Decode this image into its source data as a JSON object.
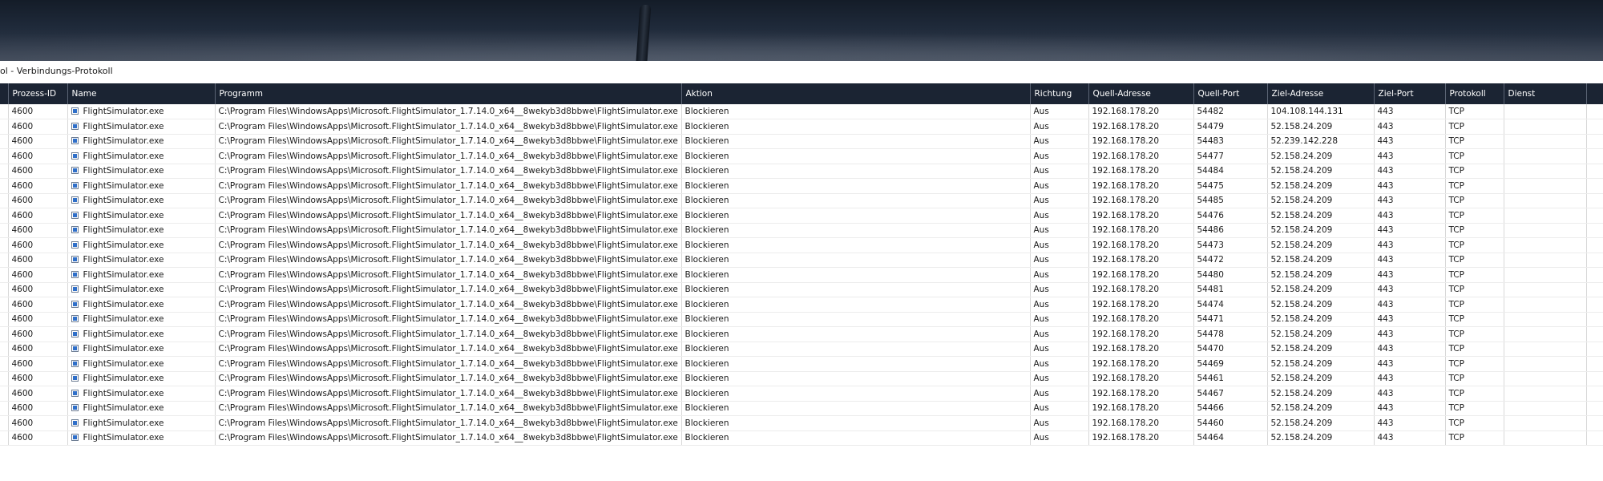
{
  "window": {
    "title": "ol - Verbindungs-Protokoll"
  },
  "icons": {
    "row_app_icon": "application-icon"
  },
  "colors": {
    "header_bg": "#1b2433",
    "header_text": "#ffffff",
    "row_border": "#ececec"
  },
  "table": {
    "columns": [
      "",
      "Prozess-ID",
      "Name",
      "Programm",
      "Aktion",
      "Richtung",
      "Quell-Adresse",
      "Quell-Port",
      "Ziel-Adresse",
      "Ziel-Port",
      "Protokoll",
      "Dienst",
      ""
    ],
    "rows": [
      {
        "pid": "4600",
        "name": "FlightSimulator.exe",
        "program": "C:\\Program Files\\WindowsApps\\Microsoft.FlightSimulator_1.7.14.0_x64__8wekyb3d8bbwe\\FlightSimulator.exe",
        "action": "Blockieren",
        "direction": "Aus",
        "src_addr": "192.168.178.20",
        "src_port": "54482",
        "dst_addr": "104.108.144.131",
        "dst_port": "443",
        "protocol": "TCP",
        "service": ""
      },
      {
        "pid": "4600",
        "name": "FlightSimulator.exe",
        "program": "C:\\Program Files\\WindowsApps\\Microsoft.FlightSimulator_1.7.14.0_x64__8wekyb3d8bbwe\\FlightSimulator.exe",
        "action": "Blockieren",
        "direction": "Aus",
        "src_addr": "192.168.178.20",
        "src_port": "54479",
        "dst_addr": "52.158.24.209",
        "dst_port": "443",
        "protocol": "TCP",
        "service": ""
      },
      {
        "pid": "4600",
        "name": "FlightSimulator.exe",
        "program": "C:\\Program Files\\WindowsApps\\Microsoft.FlightSimulator_1.7.14.0_x64__8wekyb3d8bbwe\\FlightSimulator.exe",
        "action": "Blockieren",
        "direction": "Aus",
        "src_addr": "192.168.178.20",
        "src_port": "54483",
        "dst_addr": "52.239.142.228",
        "dst_port": "443",
        "protocol": "TCP",
        "service": ""
      },
      {
        "pid": "4600",
        "name": "FlightSimulator.exe",
        "program": "C:\\Program Files\\WindowsApps\\Microsoft.FlightSimulator_1.7.14.0_x64__8wekyb3d8bbwe\\FlightSimulator.exe",
        "action": "Blockieren",
        "direction": "Aus",
        "src_addr": "192.168.178.20",
        "src_port": "54477",
        "dst_addr": "52.158.24.209",
        "dst_port": "443",
        "protocol": "TCP",
        "service": ""
      },
      {
        "pid": "4600",
        "name": "FlightSimulator.exe",
        "program": "C:\\Program Files\\WindowsApps\\Microsoft.FlightSimulator_1.7.14.0_x64__8wekyb3d8bbwe\\FlightSimulator.exe",
        "action": "Blockieren",
        "direction": "Aus",
        "src_addr": "192.168.178.20",
        "src_port": "54484",
        "dst_addr": "52.158.24.209",
        "dst_port": "443",
        "protocol": "TCP",
        "service": ""
      },
      {
        "pid": "4600",
        "name": "FlightSimulator.exe",
        "program": "C:\\Program Files\\WindowsApps\\Microsoft.FlightSimulator_1.7.14.0_x64__8wekyb3d8bbwe\\FlightSimulator.exe",
        "action": "Blockieren",
        "direction": "Aus",
        "src_addr": "192.168.178.20",
        "src_port": "54475",
        "dst_addr": "52.158.24.209",
        "dst_port": "443",
        "protocol": "TCP",
        "service": ""
      },
      {
        "pid": "4600",
        "name": "FlightSimulator.exe",
        "program": "C:\\Program Files\\WindowsApps\\Microsoft.FlightSimulator_1.7.14.0_x64__8wekyb3d8bbwe\\FlightSimulator.exe",
        "action": "Blockieren",
        "direction": "Aus",
        "src_addr": "192.168.178.20",
        "src_port": "54485",
        "dst_addr": "52.158.24.209",
        "dst_port": "443",
        "protocol": "TCP",
        "service": ""
      },
      {
        "pid": "4600",
        "name": "FlightSimulator.exe",
        "program": "C:\\Program Files\\WindowsApps\\Microsoft.FlightSimulator_1.7.14.0_x64__8wekyb3d8bbwe\\FlightSimulator.exe",
        "action": "Blockieren",
        "direction": "Aus",
        "src_addr": "192.168.178.20",
        "src_port": "54476",
        "dst_addr": "52.158.24.209",
        "dst_port": "443",
        "protocol": "TCP",
        "service": ""
      },
      {
        "pid": "4600",
        "name": "FlightSimulator.exe",
        "program": "C:\\Program Files\\WindowsApps\\Microsoft.FlightSimulator_1.7.14.0_x64__8wekyb3d8bbwe\\FlightSimulator.exe",
        "action": "Blockieren",
        "direction": "Aus",
        "src_addr": "192.168.178.20",
        "src_port": "54486",
        "dst_addr": "52.158.24.209",
        "dst_port": "443",
        "protocol": "TCP",
        "service": ""
      },
      {
        "pid": "4600",
        "name": "FlightSimulator.exe",
        "program": "C:\\Program Files\\WindowsApps\\Microsoft.FlightSimulator_1.7.14.0_x64__8wekyb3d8bbwe\\FlightSimulator.exe",
        "action": "Blockieren",
        "direction": "Aus",
        "src_addr": "192.168.178.20",
        "src_port": "54473",
        "dst_addr": "52.158.24.209",
        "dst_port": "443",
        "protocol": "TCP",
        "service": ""
      },
      {
        "pid": "4600",
        "name": "FlightSimulator.exe",
        "program": "C:\\Program Files\\WindowsApps\\Microsoft.FlightSimulator_1.7.14.0_x64__8wekyb3d8bbwe\\FlightSimulator.exe",
        "action": "Blockieren",
        "direction": "Aus",
        "src_addr": "192.168.178.20",
        "src_port": "54472",
        "dst_addr": "52.158.24.209",
        "dst_port": "443",
        "protocol": "TCP",
        "service": ""
      },
      {
        "pid": "4600",
        "name": "FlightSimulator.exe",
        "program": "C:\\Program Files\\WindowsApps\\Microsoft.FlightSimulator_1.7.14.0_x64__8wekyb3d8bbwe\\FlightSimulator.exe",
        "action": "Blockieren",
        "direction": "Aus",
        "src_addr": "192.168.178.20",
        "src_port": "54480",
        "dst_addr": "52.158.24.209",
        "dst_port": "443",
        "protocol": "TCP",
        "service": ""
      },
      {
        "pid": "4600",
        "name": "FlightSimulator.exe",
        "program": "C:\\Program Files\\WindowsApps\\Microsoft.FlightSimulator_1.7.14.0_x64__8wekyb3d8bbwe\\FlightSimulator.exe",
        "action": "Blockieren",
        "direction": "Aus",
        "src_addr": "192.168.178.20",
        "src_port": "54481",
        "dst_addr": "52.158.24.209",
        "dst_port": "443",
        "protocol": "TCP",
        "service": ""
      },
      {
        "pid": "4600",
        "name": "FlightSimulator.exe",
        "program": "C:\\Program Files\\WindowsApps\\Microsoft.FlightSimulator_1.7.14.0_x64__8wekyb3d8bbwe\\FlightSimulator.exe",
        "action": "Blockieren",
        "direction": "Aus",
        "src_addr": "192.168.178.20",
        "src_port": "54474",
        "dst_addr": "52.158.24.209",
        "dst_port": "443",
        "protocol": "TCP",
        "service": ""
      },
      {
        "pid": "4600",
        "name": "FlightSimulator.exe",
        "program": "C:\\Program Files\\WindowsApps\\Microsoft.FlightSimulator_1.7.14.0_x64__8wekyb3d8bbwe\\FlightSimulator.exe",
        "action": "Blockieren",
        "direction": "Aus",
        "src_addr": "192.168.178.20",
        "src_port": "54471",
        "dst_addr": "52.158.24.209",
        "dst_port": "443",
        "protocol": "TCP",
        "service": ""
      },
      {
        "pid": "4600",
        "name": "FlightSimulator.exe",
        "program": "C:\\Program Files\\WindowsApps\\Microsoft.FlightSimulator_1.7.14.0_x64__8wekyb3d8bbwe\\FlightSimulator.exe",
        "action": "Blockieren",
        "direction": "Aus",
        "src_addr": "192.168.178.20",
        "src_port": "54478",
        "dst_addr": "52.158.24.209",
        "dst_port": "443",
        "protocol": "TCP",
        "service": ""
      },
      {
        "pid": "4600",
        "name": "FlightSimulator.exe",
        "program": "C:\\Program Files\\WindowsApps\\Microsoft.FlightSimulator_1.7.14.0_x64__8wekyb3d8bbwe\\FlightSimulator.exe",
        "action": "Blockieren",
        "direction": "Aus",
        "src_addr": "192.168.178.20",
        "src_port": "54470",
        "dst_addr": "52.158.24.209",
        "dst_port": "443",
        "protocol": "TCP",
        "service": ""
      },
      {
        "pid": "4600",
        "name": "FlightSimulator.exe",
        "program": "C:\\Program Files\\WindowsApps\\Microsoft.FlightSimulator_1.7.14.0_x64__8wekyb3d8bbwe\\FlightSimulator.exe",
        "action": "Blockieren",
        "direction": "Aus",
        "src_addr": "192.168.178.20",
        "src_port": "54469",
        "dst_addr": "52.158.24.209",
        "dst_port": "443",
        "protocol": "TCP",
        "service": ""
      },
      {
        "pid": "4600",
        "name": "FlightSimulator.exe",
        "program": "C:\\Program Files\\WindowsApps\\Microsoft.FlightSimulator_1.7.14.0_x64__8wekyb3d8bbwe\\FlightSimulator.exe",
        "action": "Blockieren",
        "direction": "Aus",
        "src_addr": "192.168.178.20",
        "src_port": "54461",
        "dst_addr": "52.158.24.209",
        "dst_port": "443",
        "protocol": "TCP",
        "service": ""
      },
      {
        "pid": "4600",
        "name": "FlightSimulator.exe",
        "program": "C:\\Program Files\\WindowsApps\\Microsoft.FlightSimulator_1.7.14.0_x64__8wekyb3d8bbwe\\FlightSimulator.exe",
        "action": "Blockieren",
        "direction": "Aus",
        "src_addr": "192.168.178.20",
        "src_port": "54467",
        "dst_addr": "52.158.24.209",
        "dst_port": "443",
        "protocol": "TCP",
        "service": ""
      },
      {
        "pid": "4600",
        "name": "FlightSimulator.exe",
        "program": "C:\\Program Files\\WindowsApps\\Microsoft.FlightSimulator_1.7.14.0_x64__8wekyb3d8bbwe\\FlightSimulator.exe",
        "action": "Blockieren",
        "direction": "Aus",
        "src_addr": "192.168.178.20",
        "src_port": "54466",
        "dst_addr": "52.158.24.209",
        "dst_port": "443",
        "protocol": "TCP",
        "service": ""
      },
      {
        "pid": "4600",
        "name": "FlightSimulator.exe",
        "program": "C:\\Program Files\\WindowsApps\\Microsoft.FlightSimulator_1.7.14.0_x64__8wekyb3d8bbwe\\FlightSimulator.exe",
        "action": "Blockieren",
        "direction": "Aus",
        "src_addr": "192.168.178.20",
        "src_port": "54460",
        "dst_addr": "52.158.24.209",
        "dst_port": "443",
        "protocol": "TCP",
        "service": ""
      },
      {
        "pid": "4600",
        "name": "FlightSimulator.exe",
        "program": "C:\\Program Files\\WindowsApps\\Microsoft.FlightSimulator_1.7.14.0_x64__8wekyb3d8bbwe\\FlightSimulator.exe",
        "action": "Blockieren",
        "direction": "Aus",
        "src_addr": "192.168.178.20",
        "src_port": "54464",
        "dst_addr": "52.158.24.209",
        "dst_port": "443",
        "protocol": "TCP",
        "service": ""
      }
    ]
  }
}
